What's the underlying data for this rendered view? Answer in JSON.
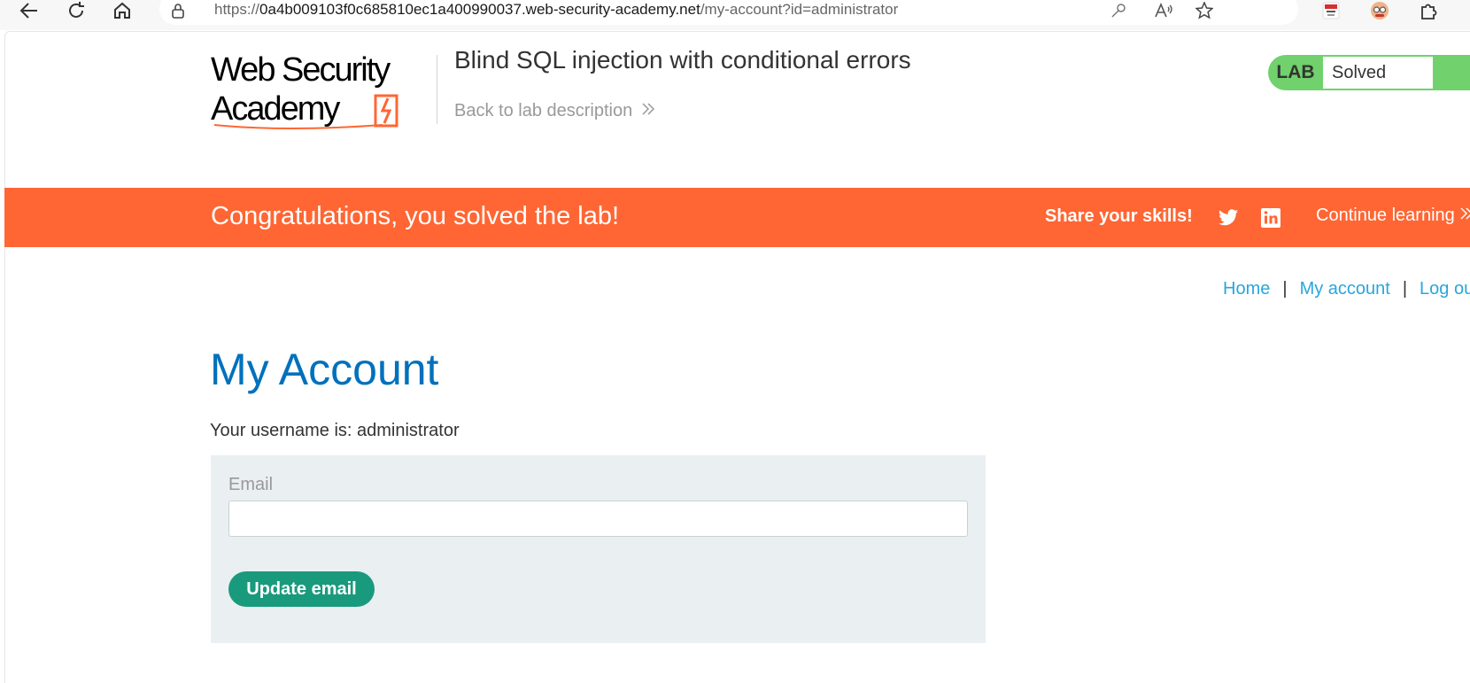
{
  "browser": {
    "url_prefix": "https://",
    "url_host": "0a4b009103f0c685810ec1a400990037.web-security-academy.net",
    "url_path": "/my-account?id=administrator"
  },
  "header": {
    "logo_line1": "Web Security",
    "logo_line2": "Academy",
    "lab_title": "Blind SQL injection with conditional errors",
    "back_link": "Back to lab description",
    "lab_tag": "LAB",
    "lab_status": "Solved"
  },
  "banner": {
    "message": "Congratulations, you solved the lab!",
    "share_label": "Share your skills!",
    "continue_label": "Continue learning"
  },
  "nav": {
    "home": "Home",
    "my_account": "My account",
    "log_out": "Log out",
    "separator": "|"
  },
  "main": {
    "heading": "My Account",
    "username_text": "Your username is: administrator",
    "email_label": "Email",
    "email_value": "",
    "update_button": "Update email"
  },
  "colors": {
    "accent_orange": "#ff6633",
    "heading_blue": "#0071bc",
    "link_blue": "#29a6db",
    "button_green": "#1a9a7d",
    "solved_green": "#70d16d"
  }
}
